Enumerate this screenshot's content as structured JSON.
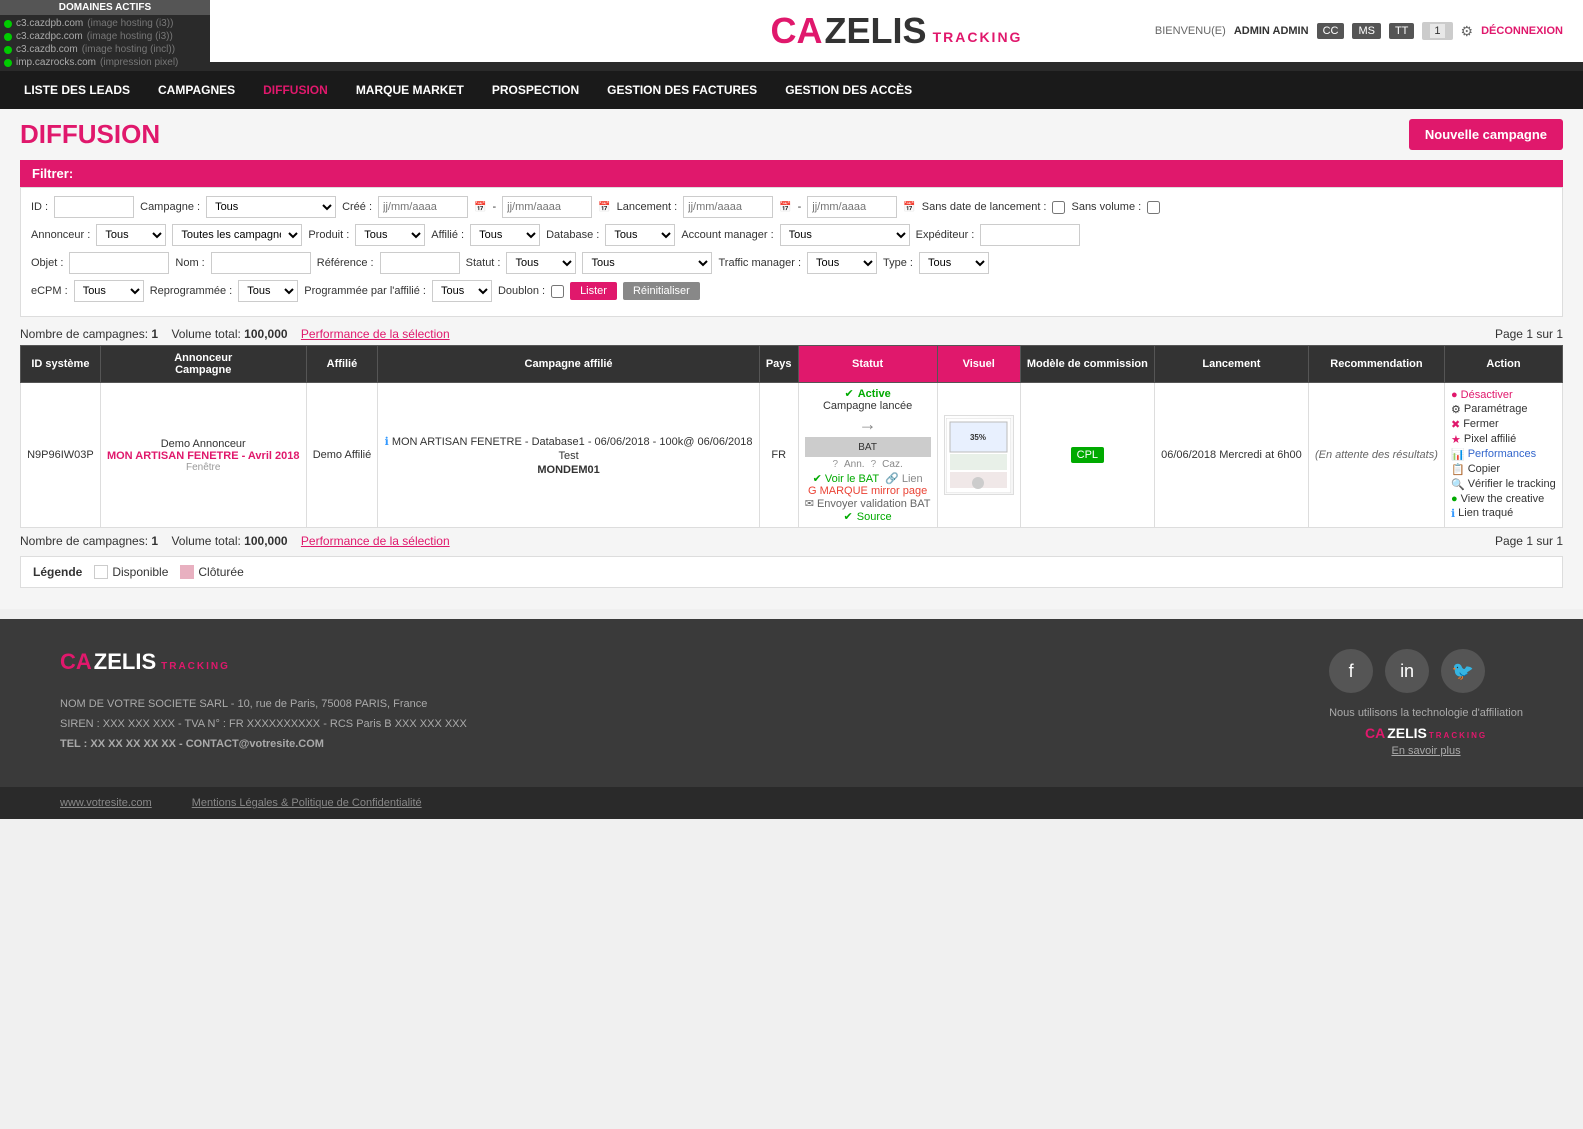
{
  "domainBar": {
    "title": "DOMAINES ACTIFS",
    "domains": [
      {
        "name": "c3.cazdpb.com",
        "desc": "(image hosting (i3))",
        "color": "#00cc00"
      },
      {
        "name": "c3.cazdpc.com",
        "desc": "(image hosting (i3))",
        "color": "#00cc00"
      },
      {
        "name": "c3.cazdb.com",
        "desc": "(image hosting (incl))",
        "color": "#00cc00"
      },
      {
        "name": "imp.cazrocks.com",
        "desc": "(impression pixel)",
        "color": "#00cc00"
      }
    ]
  },
  "header": {
    "logo_ca": "CA",
    "logo_zelis": "ZELIS",
    "logo_tracking": "TRACKING",
    "welcome": "BIENVENU(E)",
    "user": "ADMIN ADMIN",
    "btn_cc": "CC",
    "btn_ms": "MS",
    "btn_tt": "TT",
    "btn_num": "1",
    "deconnexion": "DÉCONNEXION"
  },
  "nav": {
    "items": [
      {
        "label": "LISTE DES LEADS",
        "active": false
      },
      {
        "label": "CAMPAGNES",
        "active": false
      },
      {
        "label": "DIFFUSION",
        "active": true
      },
      {
        "label": "MARQUE MARKET",
        "active": false
      },
      {
        "label": "PROSPECTION",
        "active": false
      },
      {
        "label": "GESTION DES FACTURES",
        "active": false
      },
      {
        "label": "GESTION DES ACCÈS",
        "active": false
      }
    ]
  },
  "page": {
    "title": "DIFFUSION",
    "btn_new": "Nouvelle campagne"
  },
  "filter": {
    "title": "Filtrer:",
    "id_label": "ID :",
    "campaign_label": "Campagne :",
    "campaign_val": "Tous",
    "created_label": "Créé :",
    "date_placeholder": "jj/mm/aaaa",
    "launch_label": "Lancement :",
    "sans_date_label": "Sans date de lancement :",
    "sans_volume_label": "Sans volume :",
    "annonceur_label": "Annonceur :",
    "annonceur_val": "Tous",
    "all_campaigns": "Toutes les campagnes",
    "produit_label": "Produit :",
    "produit_val": "Tous",
    "affilie_label": "Affilié :",
    "affilie_val": "Tous",
    "database_label": "Database :",
    "database_val": "Tous",
    "account_label": "Account manager :",
    "account_val": "Tous",
    "expediteur_label": "Expéditeur :",
    "objet_label": "Objet :",
    "nom_label": "Nom :",
    "reference_label": "Référence :",
    "statut_label": "Statut :",
    "statut_val": "Tous",
    "tous_val": "Tous",
    "traffic_label": "Traffic manager :",
    "traffic_val": "Tous",
    "type_label": "Type :",
    "type_val": "Tous",
    "ecpm_label": "eCPM :",
    "ecpm_val": "Tous",
    "reprogrammee_label": "Reprogrammée :",
    "reprogrammee_val": "Tous",
    "programmee_label": "Programmée par l'affilié :",
    "programmee_val": "Tous",
    "doublon_label": "Doublon :",
    "btn_lister": "Lister",
    "btn_reinit": "Réinitialiser"
  },
  "tableInfo": {
    "count_label": "Nombre de campagnes:",
    "count": "1",
    "volume_label": "Volume total:",
    "volume": "100,000",
    "perf_label": "Performance de la sélection",
    "page_label": "Page 1 sur 1"
  },
  "tableHeaders": [
    "ID système",
    "Annonceur\nCampagne",
    "Affilié",
    "Campagne affilié",
    "Pays",
    "Statut",
    "Visuel",
    "Modèle de commission",
    "Lancement",
    "Recommendation",
    "Action"
  ],
  "tableRow": {
    "id": "N9P96IW03P",
    "annonceur": "Demo Annonceur",
    "campaign_name": "MON ARTISAN FENETRE - Avril 2018",
    "fenetre": "Fenêtre",
    "affilie": "Demo Affilié",
    "campagne_affilie_info": "MON ARTISAN FENETRE - Database1 - 06/06/2018 - 100k@ 06/06/2018",
    "campagne_affilie_test": "Test",
    "campagne_affilie_code": "MONDEM01",
    "pays": "FR",
    "status_active": "Active",
    "status_launched": "Campagne lancée",
    "bat": "BAT",
    "ann": "Ann.",
    "caz": "Caz.",
    "voir_bat": "Voir le BAT",
    "lien": "Lien",
    "marque_mirror": "MARQUE mirror page",
    "envoyer_val": "Envoyer validation BAT",
    "source": "Source",
    "modele": "CPL",
    "lancement": "06/06/2018 Mercredi at 6h00",
    "recommendation": "(En attente des résultats)",
    "actions": [
      "Désactiver",
      "Paramétrage",
      "Fermer",
      "Pixel affilié",
      "Performances",
      "Copier",
      "Vérifier le tracking",
      "View the creative",
      "Lien traqué"
    ]
  },
  "legend": {
    "label": "Légende",
    "disponible": "Disponible",
    "cloturee": "Clôturée"
  },
  "footer": {
    "logo_ca": "CA",
    "logo_zelis": "ZELIS",
    "logo_tracking": "TRACKING",
    "address": "NOM DE VOTRE SOCIETE SARL - 10, rue de Paris, 75008 PARIS, France",
    "siren": "SIREN : XXX XXX XXX - TVA N° : FR XXXXXXXXXX - RCS Paris B XXX XXX XXX",
    "tel": "TEL : XX XX XX XX XX - CONTACT@votresite.COM",
    "tech_text": "Nous utilisons la technologie d'affiliation",
    "tech_ca": "CA",
    "tech_zelis": "ZELIS",
    "tech_tracking": "TRACKING",
    "savoir_plus": "En savoir plus",
    "site": "www.votresite.com",
    "mentions": "Mentions Légales & Politique de Confidentialité"
  }
}
